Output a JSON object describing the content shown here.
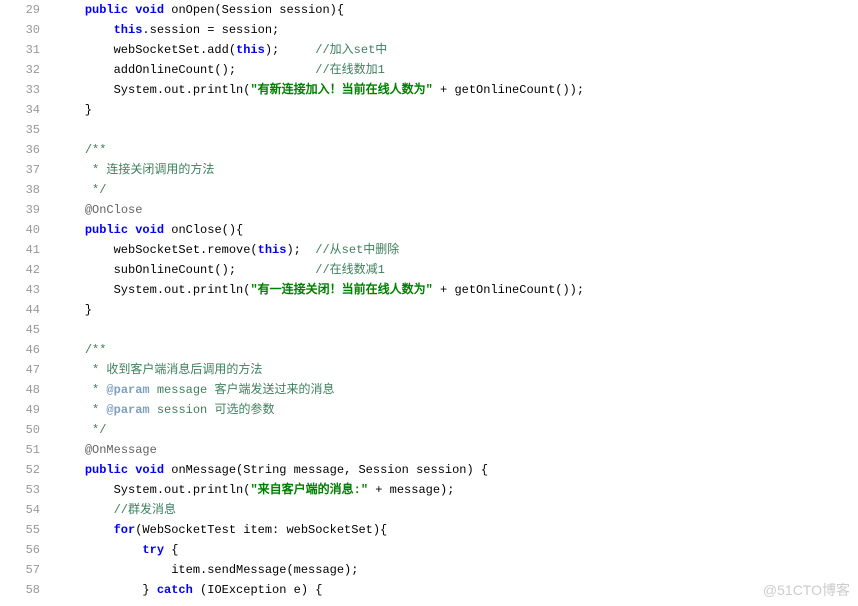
{
  "watermark": "@51CTO博客",
  "lines": [
    {
      "n": "29",
      "seg": [
        {
          "t": "    ",
          "c": ""
        },
        {
          "t": "public",
          "c": "kw"
        },
        {
          "t": " ",
          "c": ""
        },
        {
          "t": "void",
          "c": "kw"
        },
        {
          "t": " onOpen(Session session){",
          "c": ""
        }
      ]
    },
    {
      "n": "30",
      "seg": [
        {
          "t": "        ",
          "c": ""
        },
        {
          "t": "this",
          "c": "kw"
        },
        {
          "t": ".session = session;",
          "c": ""
        }
      ]
    },
    {
      "n": "31",
      "seg": [
        {
          "t": "        webSocketSet.add(",
          "c": ""
        },
        {
          "t": "this",
          "c": "kw"
        },
        {
          "t": ");     ",
          "c": ""
        },
        {
          "t": "//加入set中",
          "c": "cmt"
        }
      ]
    },
    {
      "n": "32",
      "seg": [
        {
          "t": "        addOnlineCount();           ",
          "c": ""
        },
        {
          "t": "//在线数加1",
          "c": "cmt"
        }
      ]
    },
    {
      "n": "33",
      "seg": [
        {
          "t": "        System.out.println(",
          "c": ""
        },
        {
          "t": "\"有新连接加入！当前在线人数为\"",
          "c": "str"
        },
        {
          "t": " + getOnlineCount());",
          "c": ""
        }
      ]
    },
    {
      "n": "34",
      "seg": [
        {
          "t": "    }",
          "c": ""
        }
      ]
    },
    {
      "n": "35",
      "seg": [
        {
          "t": " ",
          "c": ""
        }
      ]
    },
    {
      "n": "36",
      "seg": [
        {
          "t": "    ",
          "c": ""
        },
        {
          "t": "/**",
          "c": "cmt"
        }
      ]
    },
    {
      "n": "37",
      "seg": [
        {
          "t": "     * 连接关闭调用的方法",
          "c": "cmt"
        }
      ]
    },
    {
      "n": "38",
      "seg": [
        {
          "t": "     */",
          "c": "cmt"
        }
      ]
    },
    {
      "n": "39",
      "seg": [
        {
          "t": "    ",
          "c": ""
        },
        {
          "t": "@OnClose",
          "c": "ann"
        }
      ]
    },
    {
      "n": "40",
      "seg": [
        {
          "t": "    ",
          "c": ""
        },
        {
          "t": "public",
          "c": "kw"
        },
        {
          "t": " ",
          "c": ""
        },
        {
          "t": "void",
          "c": "kw"
        },
        {
          "t": " onClose(){",
          "c": ""
        }
      ]
    },
    {
      "n": "41",
      "seg": [
        {
          "t": "        webSocketSet.remove(",
          "c": ""
        },
        {
          "t": "this",
          "c": "kw"
        },
        {
          "t": ");  ",
          "c": ""
        },
        {
          "t": "//从set中删除",
          "c": "cmt"
        }
      ]
    },
    {
      "n": "42",
      "seg": [
        {
          "t": "        subOnlineCount();           ",
          "c": ""
        },
        {
          "t": "//在线数减1",
          "c": "cmt"
        }
      ]
    },
    {
      "n": "43",
      "seg": [
        {
          "t": "        System.out.println(",
          "c": ""
        },
        {
          "t": "\"有一连接关闭！当前在线人数为\"",
          "c": "str"
        },
        {
          "t": " + getOnlineCount());",
          "c": ""
        }
      ]
    },
    {
      "n": "44",
      "seg": [
        {
          "t": "    }",
          "c": ""
        }
      ]
    },
    {
      "n": "45",
      "seg": [
        {
          "t": " ",
          "c": ""
        }
      ]
    },
    {
      "n": "46",
      "seg": [
        {
          "t": "    ",
          "c": ""
        },
        {
          "t": "/**",
          "c": "cmt"
        }
      ]
    },
    {
      "n": "47",
      "seg": [
        {
          "t": "     * 收到客户端消息后调用的方法",
          "c": "cmt"
        }
      ]
    },
    {
      "n": "48",
      "seg": [
        {
          "t": "     * ",
          "c": "cmt"
        },
        {
          "t": "@param",
          "c": "tag"
        },
        {
          "t": " message 客户端发送过来的消息",
          "c": "cmt"
        }
      ]
    },
    {
      "n": "49",
      "seg": [
        {
          "t": "     * ",
          "c": "cmt"
        },
        {
          "t": "@param",
          "c": "tag"
        },
        {
          "t": " session 可选的参数",
          "c": "cmt"
        }
      ]
    },
    {
      "n": "50",
      "seg": [
        {
          "t": "     */",
          "c": "cmt"
        }
      ]
    },
    {
      "n": "51",
      "seg": [
        {
          "t": "    ",
          "c": ""
        },
        {
          "t": "@OnMessage",
          "c": "ann"
        }
      ]
    },
    {
      "n": "52",
      "seg": [
        {
          "t": "    ",
          "c": ""
        },
        {
          "t": "public",
          "c": "kw"
        },
        {
          "t": " ",
          "c": ""
        },
        {
          "t": "void",
          "c": "kw"
        },
        {
          "t": " onMessage(String message, Session session) {",
          "c": ""
        }
      ]
    },
    {
      "n": "53",
      "seg": [
        {
          "t": "        System.out.println(",
          "c": ""
        },
        {
          "t": "\"来自客户端的消息:\"",
          "c": "str"
        },
        {
          "t": " + message);",
          "c": ""
        }
      ]
    },
    {
      "n": "54",
      "seg": [
        {
          "t": "        ",
          "c": ""
        },
        {
          "t": "//群发消息",
          "c": "cmt"
        }
      ]
    },
    {
      "n": "55",
      "seg": [
        {
          "t": "        ",
          "c": ""
        },
        {
          "t": "for",
          "c": "kw"
        },
        {
          "t": "(WebSocketTest item: webSocketSet){",
          "c": ""
        }
      ]
    },
    {
      "n": "56",
      "seg": [
        {
          "t": "            ",
          "c": ""
        },
        {
          "t": "try",
          "c": "kw"
        },
        {
          "t": " {",
          "c": ""
        }
      ]
    },
    {
      "n": "57",
      "seg": [
        {
          "t": "                item.sendMessage(message);",
          "c": ""
        }
      ]
    },
    {
      "n": "58",
      "seg": [
        {
          "t": "            } ",
          "c": ""
        },
        {
          "t": "catch",
          "c": "kw"
        },
        {
          "t": " (IOException e) {",
          "c": ""
        }
      ]
    }
  ]
}
